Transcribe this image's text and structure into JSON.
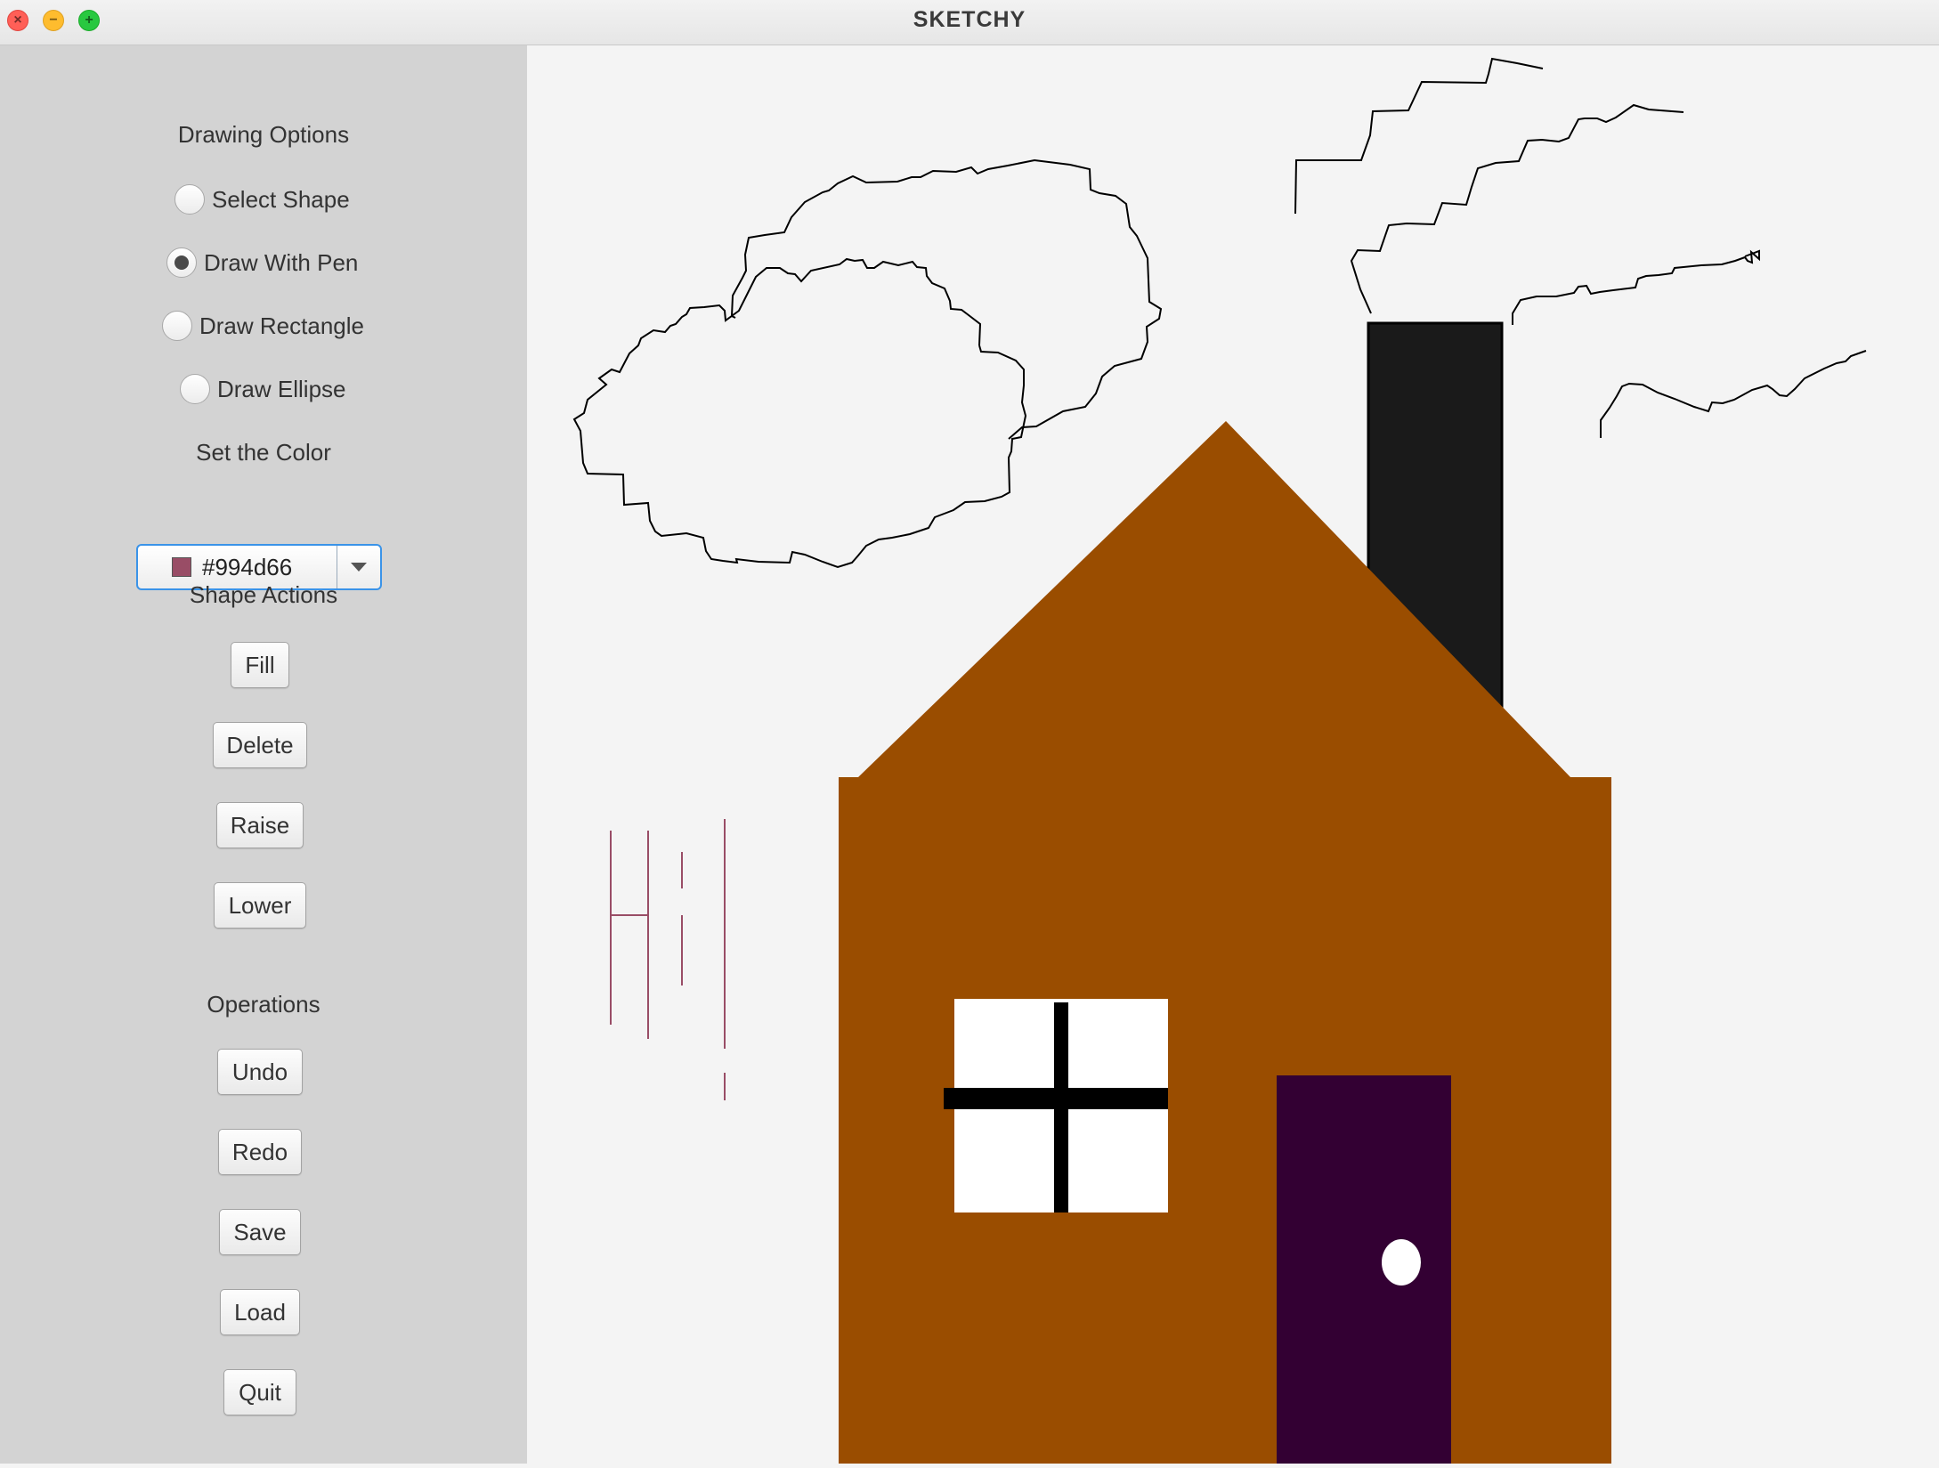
{
  "window": {
    "title": "SKETCHY"
  },
  "sidebar": {
    "drawing_options_heading": "Drawing Options",
    "modes": [
      {
        "label": "Select Shape",
        "selected": false
      },
      {
        "label": "Draw With Pen",
        "selected": true
      },
      {
        "label": "Draw Rectangle",
        "selected": false
      },
      {
        "label": "Draw Ellipse",
        "selected": false
      }
    ],
    "color_heading": "Set the Color",
    "color_picker": {
      "value": "#994d66",
      "swatch_color": "#994d66"
    },
    "shape_actions_heading": "Shape Actions",
    "shape_actions": [
      "Fill",
      "Delete",
      "Raise",
      "Lower"
    ],
    "operations_heading": "Operations",
    "operations": [
      "Undo",
      "Redo",
      "Save",
      "Load",
      "Quit"
    ]
  },
  "canvas": {
    "background": "#f4f4f4",
    "colors": {
      "house": "#9a4d00",
      "chimney": "#1a1a1a",
      "door": "#330033",
      "window": "#ffffff",
      "window_frame": "#000000",
      "knob": "#ffffff",
      "pen_black": "#000000",
      "pen_rose": "#994d66"
    }
  }
}
